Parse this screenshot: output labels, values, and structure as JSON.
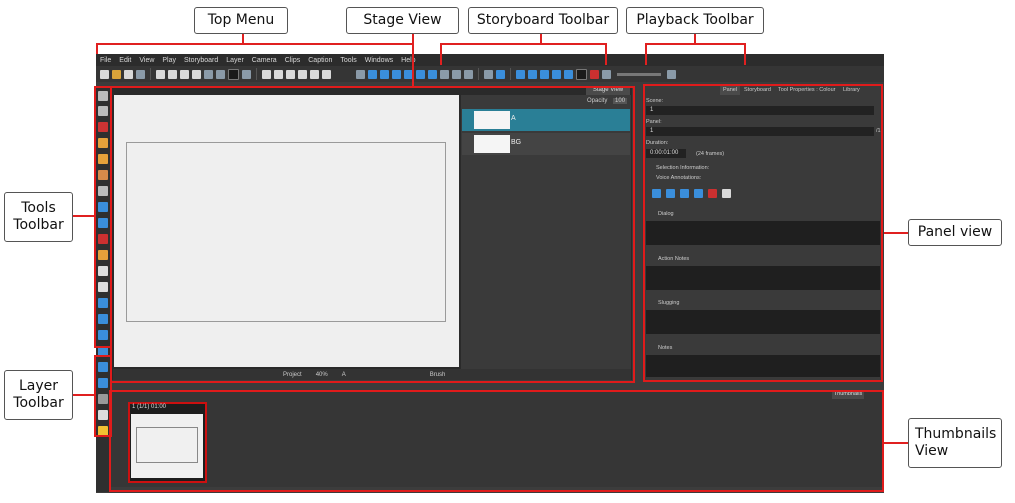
{
  "callouts": {
    "top_menu": "Top Menu",
    "stage_view": "Stage View",
    "storyboard_toolbar": "Storyboard Toolbar",
    "playback_toolbar": "Playback Toolbar",
    "tools_toolbar_l1": "Tools",
    "tools_toolbar_l2": "Toolbar",
    "layer_toolbar_l1": "Layer",
    "layer_toolbar_l2": "Toolbar",
    "panel_view": "Panel view",
    "thumbnails_view_l1": "Thumbnails",
    "thumbnails_view_l2": "View"
  },
  "menu": [
    "File",
    "Edit",
    "View",
    "Play",
    "Storyboard",
    "Layer",
    "Camera",
    "Clips",
    "Caption",
    "Tools",
    "Windows",
    "Help"
  ],
  "stage": {
    "tab_label": "Stage View",
    "opacity_label": "Opacity",
    "opacity_value": "100",
    "layers": [
      {
        "name": "A",
        "selected": true
      },
      {
        "name": "BG",
        "selected": false
      }
    ],
    "bottom_bar": {
      "view_mode": "Project",
      "zoom": "40%",
      "angle": "A",
      "tool": "Brush"
    }
  },
  "panel": {
    "tabs": [
      "Panel",
      "Storyboard",
      "Tool Properties : Colour",
      "Library"
    ],
    "scene_label": "Scene:",
    "scene_value": "1",
    "panel_label": "Panel:",
    "panel_value": "1",
    "panel_count": "/1",
    "duration_label": "Duration:",
    "duration_value": "0:00:01:00",
    "duration_frames": "(24 frames)",
    "selection_info": "Selection Information:",
    "voice_annotations": "Voice Annotations:",
    "sections": [
      "Dialog",
      "Action Notes",
      "Slugging",
      "Notes"
    ]
  },
  "thumbnails": {
    "tab_label": "Thumbnails",
    "card_title": "1 (1/1) 01:00"
  },
  "colors": {
    "highlight": "#e01b1b",
    "selected_layer": "#2a7f96",
    "app_bg": "#3c3c3c"
  }
}
